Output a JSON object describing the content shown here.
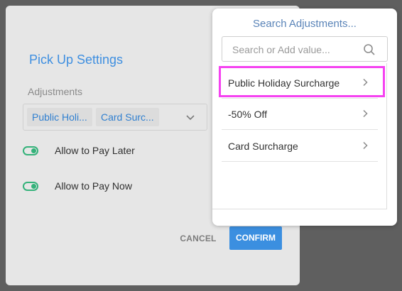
{
  "modal": {
    "title": "Pick Up Settings",
    "adjustments_label": "Adjustments",
    "selected_chips": [
      "Public Holi...",
      "Card Surc..."
    ],
    "toggles": [
      {
        "label": "Allow to Pay Later",
        "on": true
      },
      {
        "label": "Allow to Pay Now",
        "on": true
      }
    ],
    "cancel_label": "CANCEL",
    "confirm_label": "CONFIRM"
  },
  "dropdown": {
    "title": "Search Adjustments...",
    "search_placeholder": "Search or Add value...",
    "items": [
      {
        "label": "Public Holiday Surcharge"
      },
      {
        "label": "-50% Off"
      },
      {
        "label": "Card Surcharge"
      }
    ]
  },
  "colors": {
    "accent": "#3b8fe0",
    "toggle_on": "#34b27a",
    "highlight": "#f542f1"
  }
}
